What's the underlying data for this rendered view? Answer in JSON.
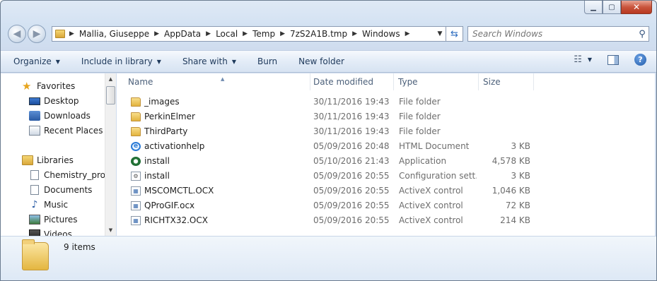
{
  "window": {
    "caption": {
      "minimize": "▁",
      "maximize": "▢",
      "close": "✕"
    }
  },
  "address": {
    "crumbs": [
      "Mallia, Giuseppe",
      "AppData",
      "Local",
      "Temp",
      "7zS2A1B.tmp",
      "Windows"
    ]
  },
  "search": {
    "placeholder": "Search Windows"
  },
  "toolbar": {
    "organize": "Organize",
    "include_in_library": "Include in library",
    "share_with": "Share with",
    "burn": "Burn",
    "new_folder": "New folder"
  },
  "nav": {
    "favorites": "Favorites",
    "desktop": "Desktop",
    "downloads": "Downloads",
    "recent_places": "Recent Places",
    "libraries": "Libraries",
    "chemistry": "Chemistry_prog",
    "documents": "Documents",
    "music": "Music",
    "pictures": "Pictures",
    "videos": "Videos"
  },
  "columns": {
    "name": "Name",
    "date": "Date modified",
    "type": "Type",
    "size": "Size"
  },
  "files": [
    {
      "name": "_images",
      "date": "30/11/2016 19:43",
      "type": "File folder",
      "size": "",
      "icon": "folder-icon"
    },
    {
      "name": "PerkinElmer",
      "date": "30/11/2016 19:43",
      "type": "File folder",
      "size": "",
      "icon": "folder-icon"
    },
    {
      "name": "ThirdParty",
      "date": "30/11/2016 19:43",
      "type": "File folder",
      "size": "",
      "icon": "folder-icon"
    },
    {
      "name": "activationhelp",
      "date": "05/09/2016 20:48",
      "type": "HTML Document",
      "size": "3 KB",
      "icon": "html-document-icon"
    },
    {
      "name": "install",
      "date": "05/10/2016 21:43",
      "type": "Application",
      "size": "4,578 KB",
      "icon": "application-icon"
    },
    {
      "name": "install",
      "date": "05/09/2016 20:55",
      "type": "Configuration sett...",
      "size": "3 KB",
      "icon": "config-file-icon"
    },
    {
      "name": "MSCOMCTL.OCX",
      "date": "05/09/2016 20:55",
      "type": "ActiveX control",
      "size": "1,046 KB",
      "icon": "activex-icon"
    },
    {
      "name": "QProGIF.ocx",
      "date": "05/09/2016 20:55",
      "type": "ActiveX control",
      "size": "72 KB",
      "icon": "activex-icon"
    },
    {
      "name": "RICHTX32.OCX",
      "date": "05/09/2016 20:55",
      "type": "ActiveX control",
      "size": "214 KB",
      "icon": "activex-icon"
    }
  ],
  "details": {
    "item_count": "9 items"
  }
}
